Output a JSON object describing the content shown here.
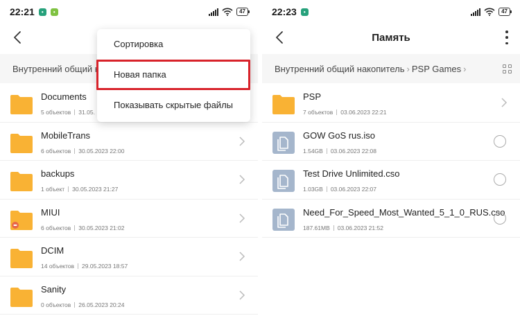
{
  "colors": {
    "folder": "#f9b234",
    "file_icon": "#a5b6cc",
    "highlight": "#d8222a",
    "status_badge": "#26a17b",
    "status_badge2": "#7fc241"
  },
  "left": {
    "status": {
      "time": "22:21",
      "badge1": "•",
      "badge2": "•",
      "battery": "47"
    },
    "crumb": "Внутренний общий на",
    "menu": [
      "Сортировка",
      "Новая папка",
      "Показывать скрытые файлы"
    ],
    "items": [
      {
        "name": "Documents",
        "count": "5 объектов",
        "date": "31.05.",
        "icon": "folder-icon"
      },
      {
        "name": "MobileTrans",
        "count": "6 объектов",
        "date": "30.05.2023 22:00",
        "icon": "folder-icon"
      },
      {
        "name": "backups",
        "count": "1 объект",
        "date": "30.05.2023 21:27",
        "icon": "folder-icon"
      },
      {
        "name": "MIUI",
        "count": "6 объектов",
        "date": "30.05.2023 21:02",
        "icon": "folder-icon"
      },
      {
        "name": "DCIM",
        "count": "14 объектов",
        "date": "29.05.2023 18:57",
        "icon": "folder-icon"
      },
      {
        "name": "Sanity",
        "count": "0 объектов",
        "date": "26.05.2023 20:24",
        "icon": "folder-icon"
      }
    ]
  },
  "right": {
    "status": {
      "time": "22:23",
      "badge1": "•",
      "battery": "47"
    },
    "title": "Память",
    "crumbs": [
      "Внутренний общий накопитель",
      "PSP Games"
    ],
    "items": [
      {
        "name": "PSP",
        "count": "7 объектов",
        "date": "03.06.2023 22:21",
        "icon": "folder-icon"
      },
      {
        "name": "GOW GoS rus.iso",
        "count": "1.54GB",
        "date": "03.06.2023 22:08",
        "icon": "file-icon"
      },
      {
        "name": "Test Drive Unlimited.cso",
        "count": "1.03GB",
        "date": "03.06.2023 22:07",
        "icon": "file-icon"
      },
      {
        "name": "Need_For_Speed_Most_Wanted_5_1_0_RUS.cso",
        "count": "187.61MB",
        "date": "03.06.2023 21:52",
        "icon": "file-icon"
      }
    ]
  }
}
